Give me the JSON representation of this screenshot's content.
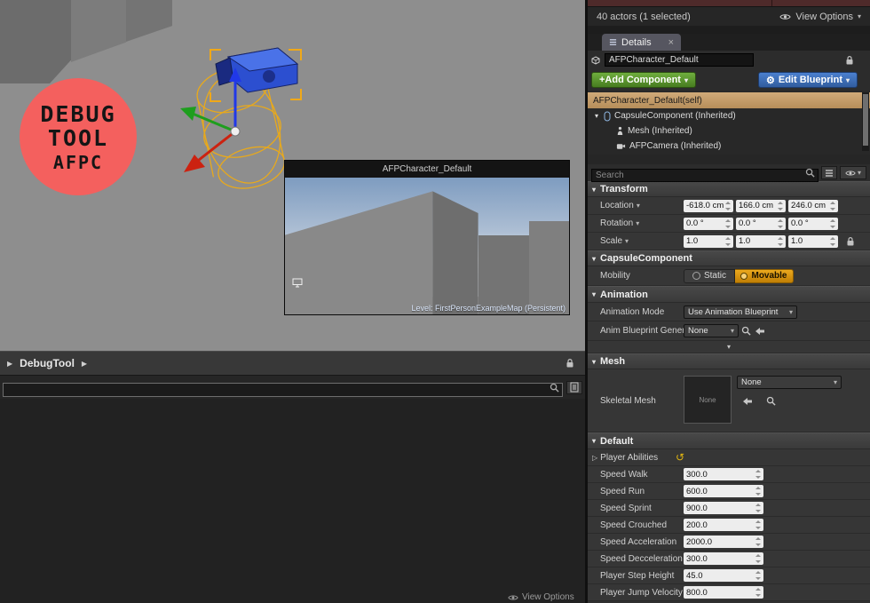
{
  "icons": {
    "caret_down": "▾",
    "tri_right": "▶",
    "tri_expand": "▷",
    "gear": "⚙",
    "close": "×",
    "reset": "↺"
  },
  "viewport": {
    "badge": {
      "line1": "DEBUG",
      "line2": "TOOL",
      "line3": "AFPC"
    },
    "preview": {
      "title": "AFPCharacter_Default",
      "level_label": "Level:  FirstPersonExampleMap (Persistent)"
    }
  },
  "debug_panel": {
    "title": "DebugTool",
    "view_options": "View Options"
  },
  "outliner": {
    "status": "40 actors (1 selected)",
    "view_options": "View Options"
  },
  "details": {
    "tab_label": "Details",
    "name_value": "AFPCharacter_Default",
    "add_component_label": "+Add Component",
    "edit_blueprint_label": "Edit Blueprint",
    "components": {
      "self_row": "AFPCharacter_Default(self)",
      "capsule_row": "CapsuleComponent (Inherited)",
      "mesh_row": "Mesh (Inherited)",
      "camera_row": "AFPCamera (Inherited)"
    },
    "search_placeholder": "Search",
    "transform": {
      "header": "Transform",
      "location": {
        "label": "Location",
        "x": "-618.0 cm",
        "y": "166.0 cm",
        "z": "246.0 cm"
      },
      "rotation": {
        "label": "Rotation",
        "x": "0.0 °",
        "y": "0.0 °",
        "z": "0.0 °"
      },
      "scale": {
        "label": "Scale",
        "x": "1.0",
        "y": "1.0",
        "z": "1.0"
      }
    },
    "capsule_section": {
      "header": "CapsuleComponent",
      "mobility_label": "Mobility",
      "options": {
        "static": "Static",
        "movable": "Movable"
      },
      "selected": "Movable"
    },
    "animation": {
      "header": "Animation",
      "mode_label": "Animation Mode",
      "mode_value": "Use Animation Blueprint",
      "blueprint_label": "Anim Blueprint Genera",
      "blueprint_value": "None"
    },
    "mesh_section": {
      "header": "Mesh",
      "skeletal_label": "Skeletal Mesh",
      "thumb_label": "None",
      "value": "None"
    },
    "default_section": {
      "header": "Default",
      "abilities_label": "Player Abilities",
      "fields": [
        {
          "label": "Speed Walk",
          "value": "300.0"
        },
        {
          "label": "Speed Run",
          "value": "600.0"
        },
        {
          "label": "Speed Sprint",
          "value": "900.0"
        },
        {
          "label": "Speed Crouched",
          "value": "200.0"
        },
        {
          "label": "Speed Acceleration",
          "value": "2000.0"
        },
        {
          "label": "Speed Decceleration",
          "value": "300.0"
        },
        {
          "label": "Player Step Height",
          "value": "45.0"
        },
        {
          "label": "Player Jump Velocity",
          "value": "800.0"
        }
      ]
    },
    "colors": {
      "accent_green": "#4e8a28",
      "accent_blue": "#3a6fb5",
      "movable_orange": "#d79a0b",
      "selection_tan": "#c39a68"
    }
  }
}
